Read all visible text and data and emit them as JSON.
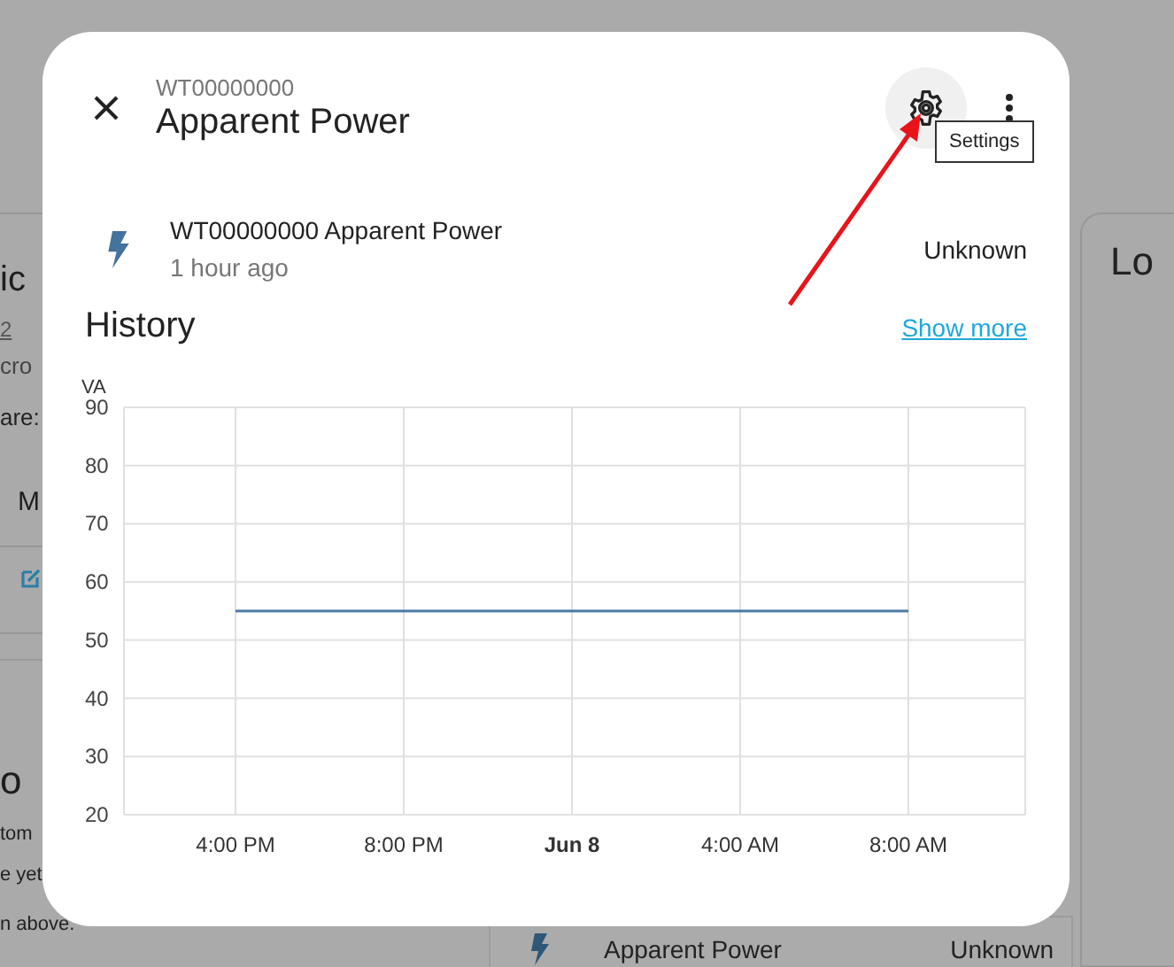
{
  "background": {
    "left_card": {
      "heading": "ic",
      "link": "2",
      "line_1": "cro",
      "line_2": "are:",
      "button": "M",
      "section_heading": "o",
      "text_lines": [
        "tom",
        "e yet.",
        "n above."
      ]
    },
    "bottom_card": {
      "entity": "Apparent Power",
      "state": "Unknown"
    },
    "right_card": {
      "heading": "Lo"
    }
  },
  "dialog": {
    "subtitle": "WT00000000",
    "title": "Apparent Power",
    "settings_tooltip": "Settings",
    "entity": {
      "name": "WT00000000 Apparent Power",
      "last_changed": "1 hour ago",
      "state": "Unknown"
    },
    "history": {
      "heading": "History",
      "show_more": "Show more",
      "chart_data": {
        "type": "line",
        "ylabel": "VA",
        "categories": [
          "4:00 PM",
          "8:00 PM",
          "**Jun 8**",
          "4:00 AM",
          "8:00 AM"
        ],
        "ylim": [
          20,
          90
        ],
        "grid": true,
        "yticks": [
          20,
          30,
          40,
          50,
          60,
          70,
          80,
          90
        ],
        "series": [
          {
            "color": "#4e79a7",
            "values": [
              55,
              55,
              55,
              55,
              55
            ]
          }
        ]
      }
    }
  }
}
